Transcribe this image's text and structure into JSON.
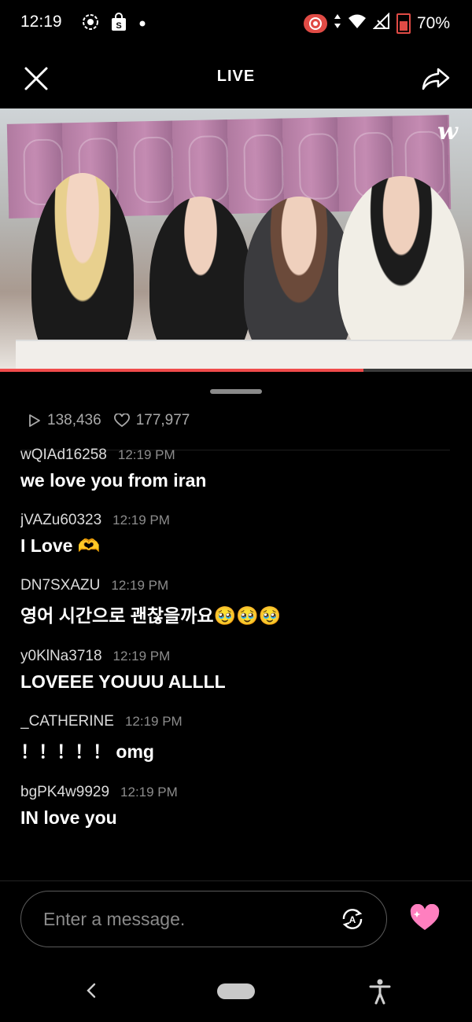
{
  "status_bar": {
    "time": "12:19",
    "battery": "70%",
    "icons": [
      "screen-record-icon",
      "shopping-bag-icon",
      "dot-icon",
      "record-pill-icon",
      "data-arrows-icon",
      "wifi-icon",
      "signal-icon",
      "battery-icon"
    ]
  },
  "header": {
    "title": "LIVE",
    "close_icon": "close-icon",
    "share_icon": "share-icon"
  },
  "video": {
    "logo": "w",
    "progress": 0.77,
    "accent": "#f04b4b"
  },
  "stats": {
    "views": "138,436",
    "likes": "177,977"
  },
  "chat": {
    "messages": [
      {
        "user": "wQIAd16258",
        "time": "12:19 PM",
        "text": "we love you from iran"
      },
      {
        "user": "jVAZu60323",
        "time": "12:19 PM",
        "text": "I Love 🫶"
      },
      {
        "user": "DN7SXAZU",
        "time": "12:19 PM",
        "text": "영어 시간으로 괜찮을까요🥹🥹🥹"
      },
      {
        "user": "y0KlNa3718",
        "time": "12:19 PM",
        "text": "LOVEEE YOUUU ALLLL"
      },
      {
        "user": "_CATHERINE",
        "time": "12:19 PM",
        "text": "！！！！！ omg"
      },
      {
        "user": "bgPK4w9929",
        "time": "12:19 PM",
        "text": "IN love you"
      }
    ]
  },
  "composer": {
    "placeholder": "Enter a message.",
    "heart_color": "#ff7fbf"
  }
}
